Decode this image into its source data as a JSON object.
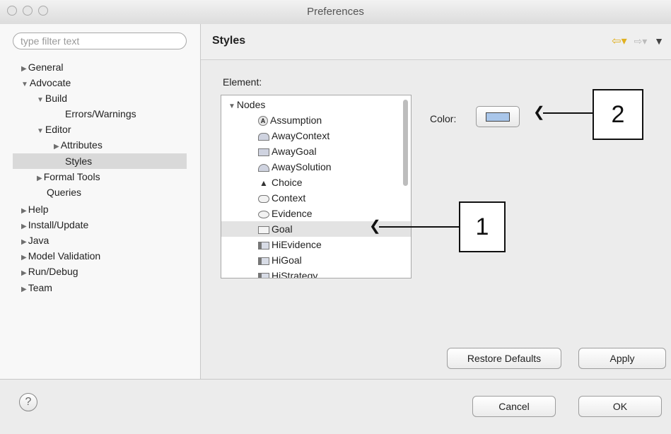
{
  "window": {
    "title": "Preferences"
  },
  "sidebar": {
    "filter_placeholder": "type filter text",
    "tree": [
      {
        "label": "General",
        "expander": "▶"
      },
      {
        "label": "Advocate",
        "expander": "▼"
      },
      {
        "label": "Build",
        "expander": "▼"
      },
      {
        "label": "Errors/Warnings",
        "expander": ""
      },
      {
        "label": "Editor",
        "expander": "▼"
      },
      {
        "label": "Attributes",
        "expander": "▶"
      },
      {
        "label": "Styles",
        "expander": ""
      },
      {
        "label": "Formal Tools",
        "expander": "▶"
      },
      {
        "label": "Queries",
        "expander": ""
      },
      {
        "label": "Help",
        "expander": "▶"
      },
      {
        "label": "Install/Update",
        "expander": "▶"
      },
      {
        "label": "Java",
        "expander": "▶"
      },
      {
        "label": "Model Validation",
        "expander": "▶"
      },
      {
        "label": "Run/Debug",
        "expander": "▶"
      },
      {
        "label": "Team",
        "expander": "▶"
      }
    ]
  },
  "content": {
    "page_title": "Styles",
    "nav_arrows": {
      "back": "⇦▾",
      "forward": "⇨▾",
      "menu": "▼"
    },
    "element_label": "Element:",
    "list": {
      "group": {
        "label": "Nodes",
        "expander": "▼"
      },
      "items": [
        {
          "label": "Assumption",
          "icon": "assumption-icon"
        },
        {
          "label": "AwayContext",
          "icon": "away-context-icon"
        },
        {
          "label": "AwayGoal",
          "icon": "away-goal-icon"
        },
        {
          "label": "AwaySolution",
          "icon": "away-solution-icon"
        },
        {
          "label": "Choice",
          "icon": "choice-icon"
        },
        {
          "label": "Context",
          "icon": "context-icon"
        },
        {
          "label": "Evidence",
          "icon": "evidence-icon"
        },
        {
          "label": "Goal",
          "icon": "goal-icon"
        },
        {
          "label": "HiEvidence",
          "icon": "hi-evidence-icon"
        },
        {
          "label": "HiGoal",
          "icon": "hi-goal-icon"
        },
        {
          "label": "HiStrategy",
          "icon": "hi-strategy-icon"
        }
      ]
    },
    "color_label": "Color:",
    "color_value": "#a9c6ea",
    "restore_defaults_label": "Restore Defaults",
    "apply_label": "Apply"
  },
  "footer": {
    "help_glyph": "?",
    "cancel_label": "Cancel",
    "ok_label": "OK"
  },
  "callouts": {
    "one": "1",
    "two": "2"
  }
}
